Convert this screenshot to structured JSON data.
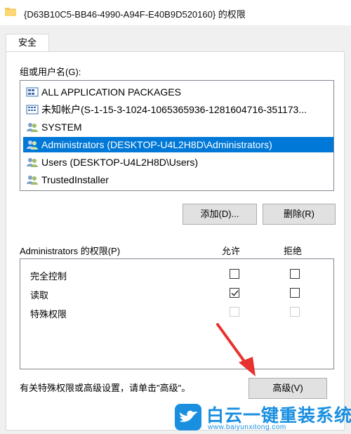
{
  "window": {
    "title": "{D63B10C5-BB46-4990-A94F-E40B9D520160} 的权限"
  },
  "tabs": [
    {
      "label": "安全"
    }
  ],
  "groups": {
    "label": "组或用户名(G):",
    "items": [
      {
        "label": "ALL APPLICATION PACKAGES",
        "icon": "app-packages-icon"
      },
      {
        "label": "未知帐户(S-1-15-3-1024-1065365936-1281604716-351173...",
        "icon": "unknown-account-icon"
      },
      {
        "label": "SYSTEM",
        "icon": "users-group-icon"
      },
      {
        "label": "Administrators (DESKTOP-U4L2H8D\\Administrators)",
        "icon": "users-group-icon",
        "selected": true
      },
      {
        "label": "Users (DESKTOP-U4L2H8D\\Users)",
        "icon": "users-group-icon"
      },
      {
        "label": "TrustedInstaller",
        "icon": "users-group-icon"
      }
    ],
    "add_button": "添加(D)...",
    "remove_button": "删除(R)"
  },
  "permissions": {
    "label": "Administrators 的权限(P)",
    "allow_header": "允许",
    "deny_header": "拒绝",
    "rows": [
      {
        "label": "完全控制",
        "allow": false,
        "deny": false,
        "enabled": true
      },
      {
        "label": "读取",
        "allow": true,
        "deny": false,
        "enabled": true
      },
      {
        "label": "特殊权限",
        "allow": false,
        "deny": false,
        "enabled": false
      }
    ]
  },
  "advanced": {
    "hint": "有关特殊权限或高级设置，请单击\"高级\"。",
    "button": "高级(V)"
  },
  "watermark": {
    "brand": "白云一键重装系统",
    "url": "www.baiyunxitong.com"
  },
  "colors": {
    "selection": "#0078d7",
    "annotation_arrow": "#e8322e",
    "watermark": "#1a8fe0"
  }
}
